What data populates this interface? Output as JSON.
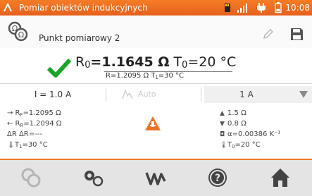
{
  "status_bar": {
    "title": "Pomiar obiektów indukcyjnych",
    "time": "10:08",
    "icons": [
      "app-logo-icon",
      "sd-card-icon",
      "signal-icon",
      "power-plug-icon",
      "battery-icon"
    ]
  },
  "point": {
    "name": "Punkt pomiarowy 2",
    "icons": [
      "inductive-measurement-icon",
      "edit-pencil-icon",
      "save-disk-icon"
    ]
  },
  "result": {
    "status_icon": "checkmark-icon",
    "main_label": "R",
    "main_sub": "0",
    "main_eq": "=",
    "main_value": "1.1645 Ω",
    "temp_label": "T",
    "temp_sub": "0",
    "temp_value": "=20 °C",
    "secondary": "R=1.2095 Ω T",
    "secondary_sub": "1",
    "secondary_tail": "=30 °C"
  },
  "settings": {
    "current": "I = 1.0 A",
    "auto_label": "Auto",
    "range_value": "1 A"
  },
  "details": {
    "left": [
      {
        "prefix": "→ R",
        "sub": "F",
        "rest": "=1.2095 Ω"
      },
      {
        "prefix": "← R",
        "sub": "R",
        "rest": "=1.2094 Ω"
      },
      {
        "prefix": "ΔR ΔR",
        "sub": "",
        "rest": "=---"
      },
      {
        "prefix": "T",
        "sub": "1",
        "rest": "=30 °C"
      }
    ],
    "right": [
      {
        "prefix": "1.5 Ω",
        "sub": "",
        "rest": ""
      },
      {
        "prefix": "0.8 Ω",
        "sub": "",
        "rest": ""
      },
      {
        "prefix": "α=0.00386 K",
        "sub": "",
        "rest": "⁻¹"
      },
      {
        "prefix": "T",
        "sub": "0",
        "rest": "=20 °C"
      }
    ],
    "warning_icon": "induction-warning-icon"
  },
  "nav": [
    "measurement-mode-icon",
    "settings-gears-icon",
    "waveform-icon",
    "help-icon",
    "home-icon"
  ],
  "colors": {
    "accent": "#f07a2a",
    "ok": "#1aa52a",
    "warning": "#e8732a"
  }
}
